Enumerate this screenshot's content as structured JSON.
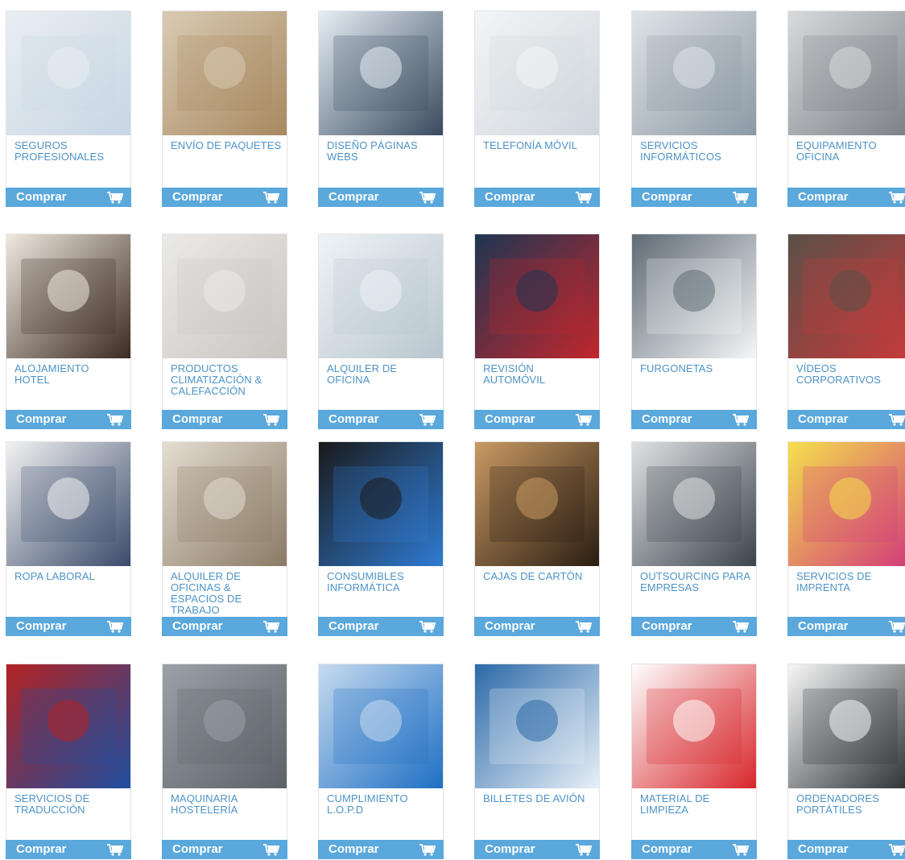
{
  "buy_label": "Comprar",
  "colors": {
    "accent": "#5aa8dc",
    "label": "#4d93c8",
    "border": "#e2e4e6"
  },
  "rows": [
    [
      {
        "label": "SEGUROS PROFESIONALES",
        "image": "office-team-photo"
      },
      {
        "label": "ENVÍO DE PAQUETES",
        "image": "courier-boxes-photo"
      },
      {
        "label": "DISEÑO PÁGINAS WEBS",
        "image": "web-screens-photo"
      },
      {
        "label": "TELEFONÍA MÓVIL",
        "image": "smartphone-photo"
      },
      {
        "label": "SERVICIOS INFORMÁTICOS",
        "image": "technician-computer-photo"
      },
      {
        "label": "EQUIPAMIENTO OFICINA",
        "image": "printer-keypad-photo"
      }
    ],
    [
      {
        "label": "ALOJAMIENTO HOTEL",
        "image": "hotel-breakfast-photo"
      },
      {
        "label": "PRODUCTOS CLIMATIZACIÓN & CALEFACCIÓN",
        "image": "air-conditioner-photo"
      },
      {
        "label": "ALQUILER DE OFICINA",
        "image": "bright-office-photo"
      },
      {
        "label": "REVISIÓN AUTOMÓVIL",
        "image": "car-inspection-photo"
      },
      {
        "label": "FURGONETAS",
        "image": "white-van-photo"
      },
      {
        "label": "VÍDEOS CORPORATIVOS",
        "image": "video-camera-photo"
      }
    ],
    [
      {
        "label": "ROPA LABORAL",
        "image": "workers-uniforms-photo"
      },
      {
        "label": "ALQUILER DE OFICINAS & ESPACIOS DE TRABAJO",
        "image": "office-space-photo"
      },
      {
        "label": "CONSUMIBLES INFORMÁTICA",
        "image": "ink-cartridges-photo"
      },
      {
        "label": "CAJAS DE CARTÓN",
        "image": "fragile-box-photo"
      },
      {
        "label": "OUTSOURCING PARA EMPRESAS",
        "image": "business-meeting-photo"
      },
      {
        "label": "SERVICIOS DE IMPRENTA",
        "image": "color-swatches-photo"
      }
    ],
    [
      {
        "label": "SERVICIOS DE TRADUCCIÓN",
        "image": "world-flags-photo"
      },
      {
        "label": "MAQUINARIA HOSTELERÍA",
        "image": "kitchen-steel-photo"
      },
      {
        "label": "CUMPLIMIENTO L.O.P.D",
        "image": "power-button-photo"
      },
      {
        "label": "BILLETES DE AVIÓN",
        "image": "airplane-sky-photo"
      },
      {
        "label": "MATERIAL DE LIMPIEZA",
        "image": "cleaning-supplies-photo"
      },
      {
        "label": "ORDENADORES PORTÁTILES",
        "image": "laptop-photo"
      }
    ]
  ]
}
